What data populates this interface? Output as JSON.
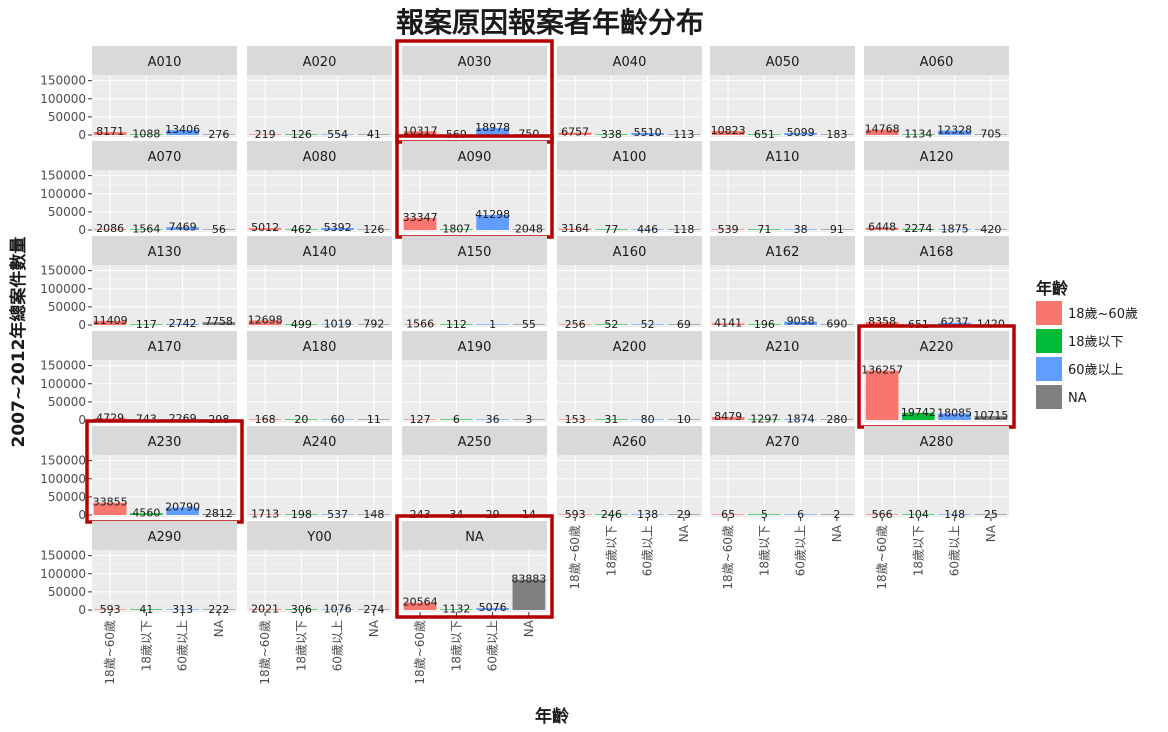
{
  "chart_data": {
    "type": "bar",
    "title": "報案原因報案者年齡分布",
    "xlabel": "年齡",
    "ylabel": "2007~2012年總案件數量",
    "categories": [
      "18歲~60歲",
      "18歲以下",
      "60歲以上",
      "NA"
    ],
    "ylim": [
      0,
      160000
    ],
    "y_ticks": [
      0,
      50000,
      100000,
      150000
    ],
    "y_tick_labels": [
      "0",
      "50000",
      "100000",
      "150000"
    ],
    "grid": true,
    "legend": {
      "title": "年齡",
      "position": "right",
      "entries": [
        "18歲~60歲",
        "18歲以下",
        "60歲以上",
        "NA"
      ]
    },
    "colors": {
      "18歲~60歲": "#F8766D",
      "18歲以下": "#00BA38",
      "60歲以上": "#619CFF",
      "NA": "#7F7F7F",
      "highlight": "#B30000",
      "panel_bg": "#EBEBEB",
      "strip_bg": "#D9D9D9"
    },
    "facets": [
      {
        "name": "A010",
        "values": [
          8171,
          1088,
          13406,
          276
        ]
      },
      {
        "name": "A020",
        "values": [
          219,
          126,
          554,
          41
        ]
      },
      {
        "name": "A030",
        "values": [
          10317,
          569,
          18978,
          750
        ],
        "highlighted": true
      },
      {
        "name": "A040",
        "values": [
          6757,
          338,
          5510,
          113
        ]
      },
      {
        "name": "A050",
        "values": [
          10823,
          651,
          5099,
          183
        ]
      },
      {
        "name": "A060",
        "values": [
          14768,
          1134,
          12328,
          705
        ]
      },
      {
        "name": "A070",
        "values": [
          2086,
          1564,
          7469,
          56
        ]
      },
      {
        "name": "A080",
        "values": [
          5012,
          462,
          5392,
          126
        ]
      },
      {
        "name": "A090",
        "values": [
          33347,
          1807,
          41298,
          2048
        ],
        "highlighted": true
      },
      {
        "name": "A100",
        "values": [
          3164,
          77,
          446,
          118
        ]
      },
      {
        "name": "A110",
        "values": [
          539,
          71,
          38,
          91
        ]
      },
      {
        "name": "A120",
        "values": [
          6448,
          2274,
          1875,
          420
        ]
      },
      {
        "name": "A130",
        "values": [
          11409,
          117,
          2742,
          7758
        ]
      },
      {
        "name": "A140",
        "values": [
          12698,
          499,
          1019,
          792
        ]
      },
      {
        "name": "A150",
        "values": [
          1566,
          112,
          1,
          55
        ]
      },
      {
        "name": "A160",
        "values": [
          256,
          52,
          52,
          69
        ]
      },
      {
        "name": "A162",
        "values": [
          4141,
          196,
          9058,
          690
        ]
      },
      {
        "name": "A168",
        "values": [
          8358,
          651,
          6237,
          1420
        ]
      },
      {
        "name": "A170",
        "values": [
          4729,
          743,
          2269,
          298
        ]
      },
      {
        "name": "A180",
        "values": [
          168,
          20,
          60,
          11
        ]
      },
      {
        "name": "A190",
        "values": [
          127,
          6,
          36,
          3
        ]
      },
      {
        "name": "A200",
        "values": [
          153,
          31,
          80,
          10
        ]
      },
      {
        "name": "A210",
        "values": [
          8479,
          1297,
          1874,
          280
        ]
      },
      {
        "name": "A220",
        "values": [
          136257,
          19742,
          18085,
          10715
        ],
        "highlighted": true
      },
      {
        "name": "A230",
        "values": [
          33855,
          4560,
          20790,
          2812
        ],
        "highlighted": true
      },
      {
        "name": "A240",
        "values": [
          1713,
          198,
          537,
          148
        ]
      },
      {
        "name": "A250",
        "values": [
          243,
          34,
          29,
          14
        ]
      },
      {
        "name": "A260",
        "values": [
          593,
          246,
          138,
          29
        ]
      },
      {
        "name": "A270",
        "values": [
          65,
          5,
          6,
          2
        ]
      },
      {
        "name": "A280",
        "values": [
          566,
          104,
          148,
          25
        ]
      },
      {
        "name": "A290",
        "values": [
          593,
          41,
          313,
          222
        ]
      },
      {
        "name": "Y00",
        "values": [
          2021,
          306,
          1076,
          274
        ]
      },
      {
        "name": "NA",
        "values": [
          20564,
          1132,
          5076,
          83883
        ],
        "highlighted": true
      }
    ]
  }
}
